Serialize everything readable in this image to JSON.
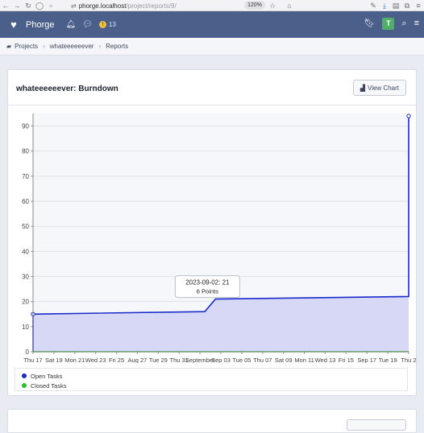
{
  "browser": {
    "url_host": "phorge.localhost",
    "url_path": "/project/reports/9/",
    "zoom": "120%"
  },
  "header": {
    "app_name": "Phorge",
    "alert_count": "13",
    "avatar_letter": "T"
  },
  "breadcrumb": [
    "Projects",
    "whateeeeeever",
    "Reports"
  ],
  "panel": {
    "title": "whateeeeeever: Burndown",
    "view_chart_label": "View Chart"
  },
  "tooltip": {
    "line1": "2023-09-02: 21",
    "line2": "6 Points"
  },
  "legend": [
    {
      "label": "Open Tasks",
      "color": "#1a2acb"
    },
    {
      "label": "Closed Tasks",
      "color": "#22c32b"
    }
  ],
  "chart_data": {
    "type": "area",
    "xlabels": [
      "Thu 17",
      "Sat 19",
      "Mon 21",
      "Wed 23",
      "Fri 25",
      "Aug 27",
      "Tue 29",
      "Thu 31",
      "September",
      "Sep 03",
      "Tue 05",
      "Thu 07",
      "Sat 09",
      "Mon 11",
      "Wed 13",
      "Fri 15",
      "Sep 17",
      "Tue 19",
      "Thu 2"
    ],
    "ylim": [
      0,
      95
    ],
    "yticks": [
      0,
      10,
      20,
      30,
      40,
      50,
      60,
      70,
      80,
      90
    ],
    "grid": true,
    "legend_position": "bottom",
    "series": [
      {
        "name": "Open Tasks",
        "color": "#1a2acb",
        "fill": "#d6d8f5",
        "points": [
          {
            "x": "2023-08-16",
            "y": 15
          },
          {
            "x": "2023-09-01",
            "y": 16
          },
          {
            "x": "2023-09-02",
            "y": 21
          },
          {
            "x": "2023-09-20",
            "y": 22
          },
          {
            "x": "2023-09-20",
            "y": 94
          }
        ]
      },
      {
        "name": "Closed Tasks",
        "color": "#22c32b",
        "points": [
          {
            "x": "2023-08-16",
            "y": 0
          },
          {
            "x": "2023-09-20",
            "y": 0
          }
        ]
      }
    ]
  }
}
